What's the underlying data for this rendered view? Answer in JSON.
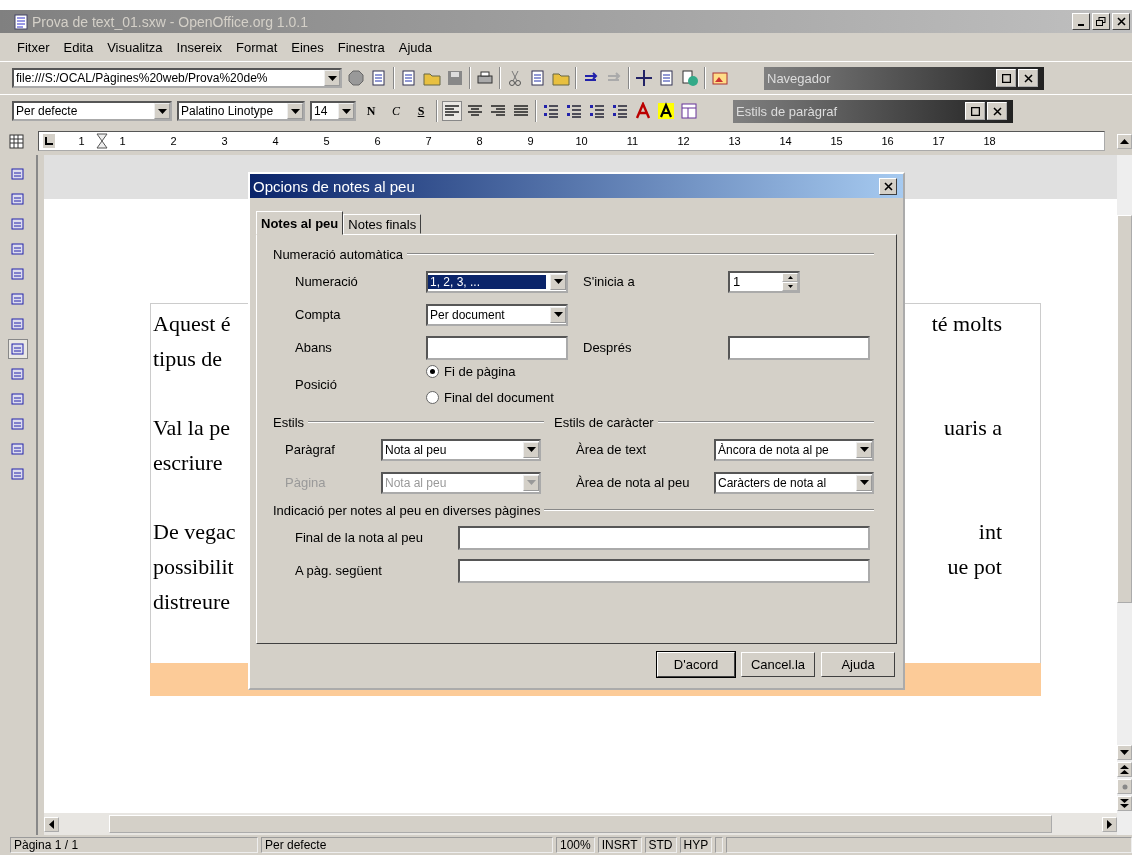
{
  "window": {
    "title": "Prova de text_01.sxw - OpenOffice.org 1.0.1"
  },
  "menu": [
    "Fitxer",
    "Edita",
    "Visualitza",
    "Insereix",
    "Format",
    "Eines",
    "Finestra",
    "Ajuda"
  ],
  "url_field": {
    "value": "file:///S:/OCAL/Pàgines%20web/Prova%20de%"
  },
  "navigator_panel": {
    "title": "Navegador"
  },
  "paragraph_styles_panel": {
    "title": "Estils de paràgraf"
  },
  "formatting": {
    "style": "Per defecte",
    "font": "Palatino Linotype",
    "size": "14",
    "bold": "N",
    "italic": "C",
    "underline": "S"
  },
  "ruler": [
    "1",
    "1",
    "2",
    "3",
    "4",
    "5",
    "6",
    "7",
    "8",
    "9",
    "10",
    "11",
    "12",
    "13",
    "14",
    "15",
    "16",
    "17",
    "18"
  ],
  "document": {
    "paragraphs": [
      {
        "lines": [
          {
            "left": "Aquest é",
            "right": "té molts"
          },
          {
            "left": "tipus de"
          }
        ]
      },
      {
        "lines": [
          {
            "left": "Val la pe",
            "right": "uaris a"
          },
          {
            "left": "escriure"
          }
        ]
      },
      {
        "lines": [
          {
            "left": "De vegac",
            "right": "int"
          },
          {
            "left": "possibilit",
            "right": "ue pot"
          },
          {
            "left": "distreure"
          }
        ]
      }
    ]
  },
  "dialog": {
    "title": "Opcions de notes al peu",
    "tabs": [
      {
        "label": "Notes al peu",
        "selected": true
      },
      {
        "label": "Notes finals",
        "selected": false
      }
    ],
    "numbering": {
      "heading": "Numeració automàtica",
      "numbering_label": "Numeració",
      "numbering_value": "1, 2, 3, ...",
      "numbering_focused": true,
      "start_label": "S'inicia a",
      "start_value": "1",
      "count_label": "Compta",
      "count_value": "Per document",
      "before_label": "Abans",
      "after_label": "Després",
      "position_label": "Posició",
      "positions": [
        {
          "label": "Fi de pàgina",
          "selected": true
        },
        {
          "label": "Final del document",
          "selected": false
        }
      ]
    },
    "styles": {
      "heading": "Estils",
      "items": [
        {
          "label": "Paràgraf",
          "value": "Nota al peu",
          "disabled": false
        },
        {
          "label": "Pàgina",
          "value": "Nota al peu",
          "disabled": true
        }
      ]
    },
    "char_styles": {
      "heading": "Estils de caràcter",
      "items": [
        {
          "label": "Àrea de text",
          "value": "Àncora de nota al pe"
        },
        {
          "label": "Àrea de nota al peu",
          "value": "Caràcters de nota al"
        }
      ]
    },
    "continuation": {
      "heading": "Indicació per notes al peu en diverses pàgines",
      "items": [
        {
          "label": "Final de la nota al peu"
        },
        {
          "label": "A pàg. següent"
        }
      ]
    },
    "buttons": [
      {
        "label": "D'acord",
        "default": true
      },
      {
        "label": "Cancel.la",
        "default": false
      },
      {
        "label": "Ajuda",
        "default": false
      }
    ]
  },
  "status_bar": {
    "page": "Pàgina  1 / 1",
    "style": "Per defecte",
    "zoom": "100%",
    "insert_mode": "INSRT",
    "selection_mode": "STD",
    "hyperlink_mode": "HYP"
  }
}
